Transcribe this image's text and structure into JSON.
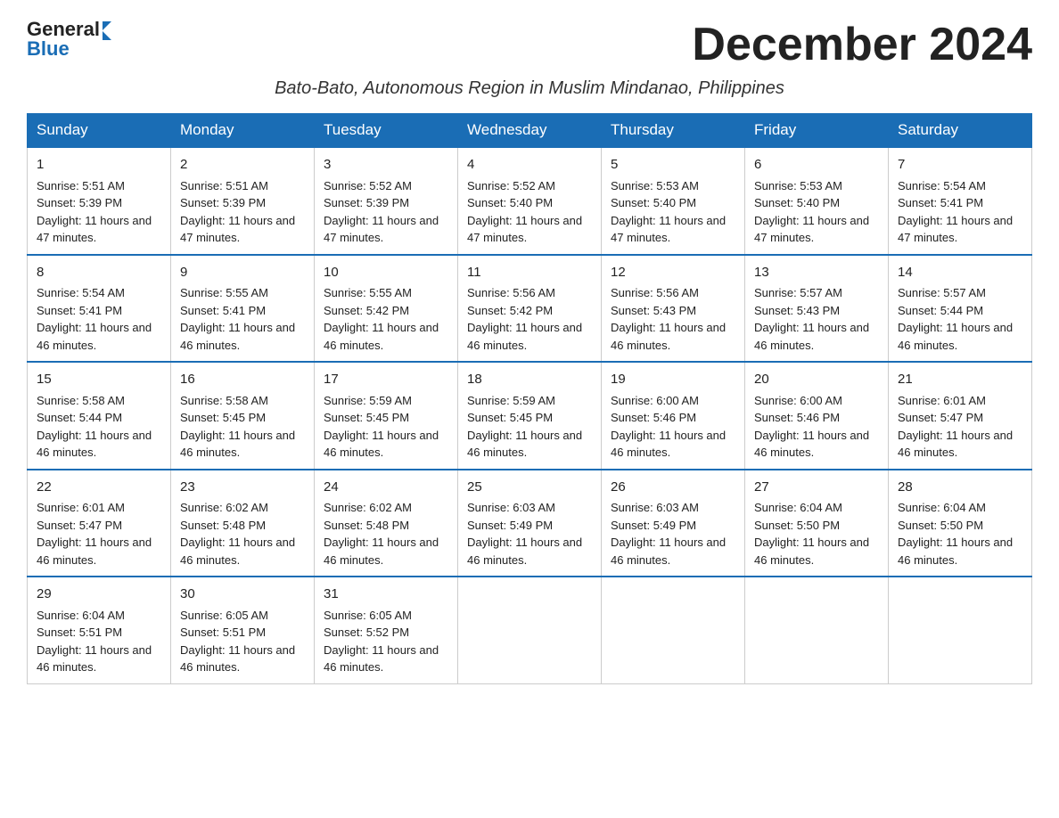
{
  "logo": {
    "text_general": "General",
    "text_blue": "Blue"
  },
  "title": "December 2024",
  "subtitle": "Bato-Bato, Autonomous Region in Muslim Mindanao, Philippines",
  "days_of_week": [
    "Sunday",
    "Monday",
    "Tuesday",
    "Wednesday",
    "Thursday",
    "Friday",
    "Saturday"
  ],
  "weeks": [
    [
      {
        "day": "1",
        "sunrise": "5:51 AM",
        "sunset": "5:39 PM",
        "daylight": "11 hours and 47 minutes."
      },
      {
        "day": "2",
        "sunrise": "5:51 AM",
        "sunset": "5:39 PM",
        "daylight": "11 hours and 47 minutes."
      },
      {
        "day": "3",
        "sunrise": "5:52 AM",
        "sunset": "5:39 PM",
        "daylight": "11 hours and 47 minutes."
      },
      {
        "day": "4",
        "sunrise": "5:52 AM",
        "sunset": "5:40 PM",
        "daylight": "11 hours and 47 minutes."
      },
      {
        "day": "5",
        "sunrise": "5:53 AM",
        "sunset": "5:40 PM",
        "daylight": "11 hours and 47 minutes."
      },
      {
        "day": "6",
        "sunrise": "5:53 AM",
        "sunset": "5:40 PM",
        "daylight": "11 hours and 47 minutes."
      },
      {
        "day": "7",
        "sunrise": "5:54 AM",
        "sunset": "5:41 PM",
        "daylight": "11 hours and 47 minutes."
      }
    ],
    [
      {
        "day": "8",
        "sunrise": "5:54 AM",
        "sunset": "5:41 PM",
        "daylight": "11 hours and 46 minutes."
      },
      {
        "day": "9",
        "sunrise": "5:55 AM",
        "sunset": "5:41 PM",
        "daylight": "11 hours and 46 minutes."
      },
      {
        "day": "10",
        "sunrise": "5:55 AM",
        "sunset": "5:42 PM",
        "daylight": "11 hours and 46 minutes."
      },
      {
        "day": "11",
        "sunrise": "5:56 AM",
        "sunset": "5:42 PM",
        "daylight": "11 hours and 46 minutes."
      },
      {
        "day": "12",
        "sunrise": "5:56 AM",
        "sunset": "5:43 PM",
        "daylight": "11 hours and 46 minutes."
      },
      {
        "day": "13",
        "sunrise": "5:57 AM",
        "sunset": "5:43 PM",
        "daylight": "11 hours and 46 minutes."
      },
      {
        "day": "14",
        "sunrise": "5:57 AM",
        "sunset": "5:44 PM",
        "daylight": "11 hours and 46 minutes."
      }
    ],
    [
      {
        "day": "15",
        "sunrise": "5:58 AM",
        "sunset": "5:44 PM",
        "daylight": "11 hours and 46 minutes."
      },
      {
        "day": "16",
        "sunrise": "5:58 AM",
        "sunset": "5:45 PM",
        "daylight": "11 hours and 46 minutes."
      },
      {
        "day": "17",
        "sunrise": "5:59 AM",
        "sunset": "5:45 PM",
        "daylight": "11 hours and 46 minutes."
      },
      {
        "day": "18",
        "sunrise": "5:59 AM",
        "sunset": "5:45 PM",
        "daylight": "11 hours and 46 minutes."
      },
      {
        "day": "19",
        "sunrise": "6:00 AM",
        "sunset": "5:46 PM",
        "daylight": "11 hours and 46 minutes."
      },
      {
        "day": "20",
        "sunrise": "6:00 AM",
        "sunset": "5:46 PM",
        "daylight": "11 hours and 46 minutes."
      },
      {
        "day": "21",
        "sunrise": "6:01 AM",
        "sunset": "5:47 PM",
        "daylight": "11 hours and 46 minutes."
      }
    ],
    [
      {
        "day": "22",
        "sunrise": "6:01 AM",
        "sunset": "5:47 PM",
        "daylight": "11 hours and 46 minutes."
      },
      {
        "day": "23",
        "sunrise": "6:02 AM",
        "sunset": "5:48 PM",
        "daylight": "11 hours and 46 minutes."
      },
      {
        "day": "24",
        "sunrise": "6:02 AM",
        "sunset": "5:48 PM",
        "daylight": "11 hours and 46 minutes."
      },
      {
        "day": "25",
        "sunrise": "6:03 AM",
        "sunset": "5:49 PM",
        "daylight": "11 hours and 46 minutes."
      },
      {
        "day": "26",
        "sunrise": "6:03 AM",
        "sunset": "5:49 PM",
        "daylight": "11 hours and 46 minutes."
      },
      {
        "day": "27",
        "sunrise": "6:04 AM",
        "sunset": "5:50 PM",
        "daylight": "11 hours and 46 minutes."
      },
      {
        "day": "28",
        "sunrise": "6:04 AM",
        "sunset": "5:50 PM",
        "daylight": "11 hours and 46 minutes."
      }
    ],
    [
      {
        "day": "29",
        "sunrise": "6:04 AM",
        "sunset": "5:51 PM",
        "daylight": "11 hours and 46 minutes."
      },
      {
        "day": "30",
        "sunrise": "6:05 AM",
        "sunset": "5:51 PM",
        "daylight": "11 hours and 46 minutes."
      },
      {
        "day": "31",
        "sunrise": "6:05 AM",
        "sunset": "5:52 PM",
        "daylight": "11 hours and 46 minutes."
      },
      null,
      null,
      null,
      null
    ]
  ],
  "labels": {
    "sunrise": "Sunrise: ",
    "sunset": "Sunset: ",
    "daylight": "Daylight: "
  }
}
